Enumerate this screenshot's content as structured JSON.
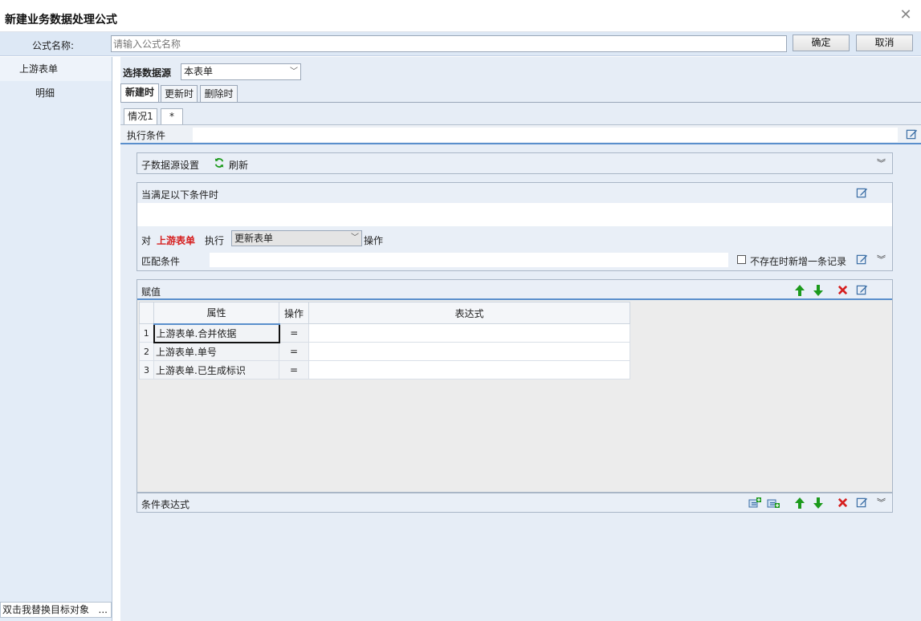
{
  "window": {
    "title": "新建业务数据处理公式",
    "close_icon": "close-icon"
  },
  "namebar": {
    "label": "公式名称:",
    "placeholder": "请输入公式名称",
    "ok_label": "确定",
    "cancel_label": "取消"
  },
  "sidebar": {
    "items": [
      {
        "label": "上游表单"
      },
      {
        "label": "明细"
      }
    ],
    "footer": {
      "text": "双击我替换目标对象",
      "more": "..."
    }
  },
  "source": {
    "label": "选择数据源",
    "selected": "本表单"
  },
  "tabs": [
    {
      "label": "新建时"
    },
    {
      "label": "更新时"
    },
    {
      "label": "删除时"
    }
  ],
  "subtabs": [
    {
      "label": "情况1"
    },
    {
      "label": "*"
    }
  ],
  "condition": {
    "label": "执行条件"
  },
  "subsource": {
    "label": "子数据源设置",
    "refresh_label": "刷新"
  },
  "when": {
    "title": "当满足以下条件时",
    "pre": "对",
    "target": "上游表单",
    "exec": "执行",
    "action": "更新表单",
    "post": "操作",
    "match_label": "匹配条件",
    "checkbox_label": "不存在时新增一条记录"
  },
  "assign": {
    "title": "赋值",
    "columns": [
      "属性",
      "操作",
      "表达式"
    ],
    "rows": [
      {
        "num": "1",
        "prop": "上游表单.合并依据",
        "op": "=",
        "expr": ""
      },
      {
        "num": "2",
        "prop": "上游表单.单号",
        "op": "=",
        "expr": ""
      },
      {
        "num": "3",
        "prop": "上游表单.已生成标识",
        "op": "=",
        "expr": ""
      }
    ]
  },
  "condexpr": {
    "title": "条件表达式"
  },
  "colors": {
    "accent": "#5a8fcc",
    "red": "#d61f1f",
    "green": "#1c9a1c"
  }
}
